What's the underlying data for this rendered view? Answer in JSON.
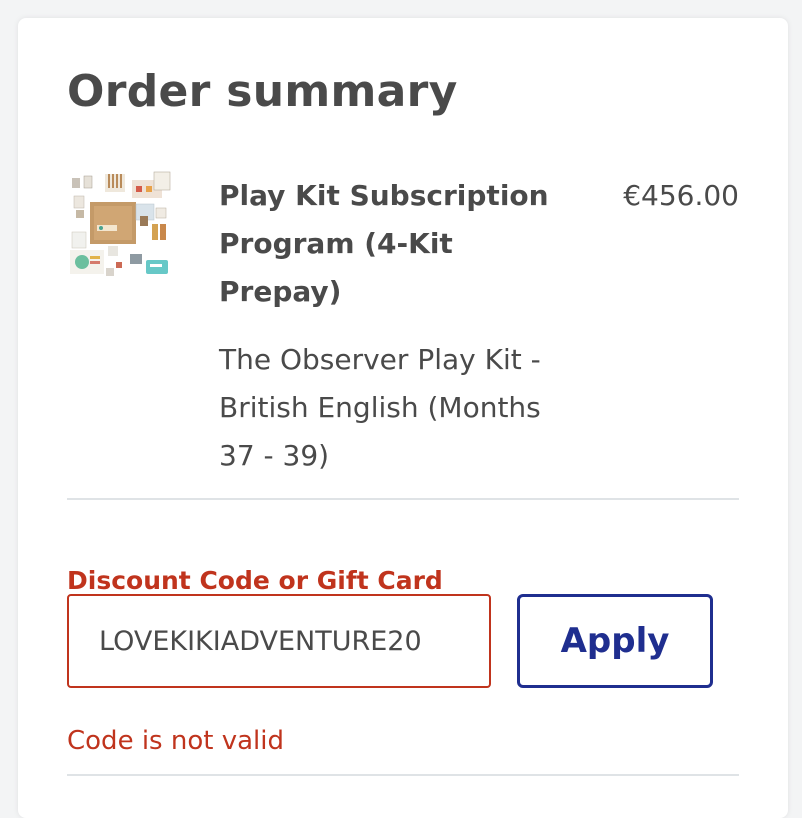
{
  "order_summary": {
    "title": "Order summary",
    "product": {
      "thumbnail": "play-kit-thumbnail",
      "name": "Play Kit Subscription Program (4-Kit Prepay)",
      "price": "€456.00",
      "variant": "The Observer Play Kit - British English (Months 37 - 39)"
    },
    "discount": {
      "label": "Discount Code or Gift Card",
      "value": "LOVEKIKIADVENTURE20",
      "apply_label": "Apply",
      "error": "Code is not valid"
    }
  },
  "colors": {
    "text": "#4a4a4a",
    "error": "#c0341d",
    "button": "#1f2e8f",
    "divider": "#dfe3e6"
  }
}
